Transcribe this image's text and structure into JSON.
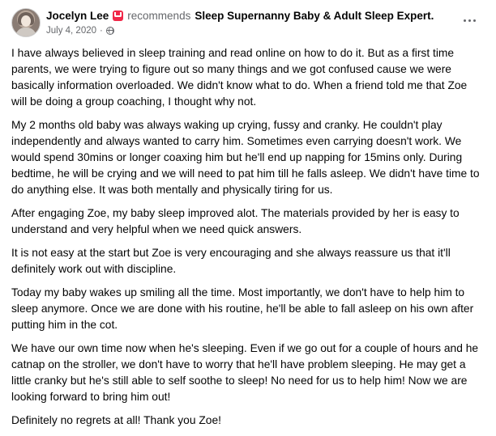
{
  "post": {
    "author_name": "Jocelyn Lee",
    "recommend_word": "recommends",
    "page_name": "Sleep Supernanny Baby & Adult Sleep Expert.",
    "date": "July 4, 2020",
    "date_separator": "·",
    "icons": {
      "recommend": "recommend-icon",
      "audience": "globe-icon",
      "more": "more-icon"
    },
    "colors": {
      "recommend_badge": "#f02849",
      "meta_gray": "#65676b",
      "text": "#050505"
    },
    "paragraphs": [
      "I have always believed in sleep training and read online on how to do it. But as a first time parents, we were trying to figure out so many things and we got confused cause we were basically information overloaded. We didn't know what to do. When a friend told me that Zoe will be doing a group coaching, I thought why not.",
      "My 2 months old baby was always waking up crying, fussy and cranky. He couldn't play independently and always wanted to carry him. Sometimes even carrying doesn't work. We would spend 30mins or longer coaxing him but he'll end up napping for 15mins only. During bedtime, he will be crying and we will need to pat him till he falls asleep. We didn't have time to do anything else. It was both mentally and physically tiring for us.",
      "After engaging Zoe, my baby sleep improved alot. The materials provided by her is easy to understand and very helpful when we need quick answers.",
      "It is not easy at the start but Zoe is very encouraging and she always reassure us that it'll definitely work out with discipline.",
      "Today my baby wakes up smiling all the time. Most importantly, we don't have to help him to sleep anymore. Once we are done with his routine, he'll be able to fall asleep on his own after putting him in the cot.",
      "We have our own time now when he's sleeping. Even if we go out for a couple of hours and he catnap on the stroller, we don't have to worry that he'll have problem sleeping. He may get a little cranky but he's still able to self soothe to sleep! No need for us to help him! Now we are looking forward to bring him out!",
      "Definitely no regrets at all! Thank you Zoe!"
    ]
  }
}
